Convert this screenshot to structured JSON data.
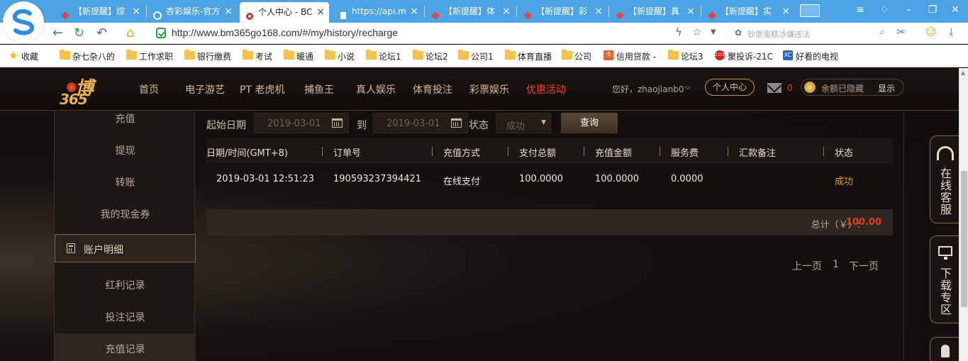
{
  "browser": {
    "tabs": [
      {
        "label": "【新提醒】综",
        "icon_color": "#e8443a"
      },
      {
        "label": "杏彩娱乐-官方",
        "icon_color": "#7a5bd6"
      },
      {
        "label": "个人中心 - BC",
        "icon_color": "#c0392b",
        "active": true
      },
      {
        "label": "https://api.m",
        "icon_color": "#9aa5b1"
      },
      {
        "label": "【新提醒】体",
        "icon_color": "#e8443a"
      },
      {
        "label": "【新提醒】彩",
        "icon_color": "#e8443a"
      },
      {
        "label": "【新提醒】真",
        "icon_color": "#e8443a"
      },
      {
        "label": "【新提醒】实",
        "icon_color": "#e8443a"
      }
    ],
    "url": "http://www.bm365go168.com/#/my/history/recharge",
    "search_placeholder": "钞票蛋糕涉嫌违法",
    "bookmarks": [
      {
        "label": "收藏",
        "kind": "star"
      },
      {
        "label": "杂七杂八的",
        "kind": "folder"
      },
      {
        "label": "工作求职",
        "kind": "folder"
      },
      {
        "label": "银行缴费",
        "kind": "folder"
      },
      {
        "label": "考试",
        "kind": "folder"
      },
      {
        "label": "暖通",
        "kind": "folder"
      },
      {
        "label": "小说",
        "kind": "folder"
      },
      {
        "label": "论坛1",
        "kind": "folder"
      },
      {
        "label": "论坛2",
        "kind": "folder"
      },
      {
        "label": "公司1",
        "kind": "folder"
      },
      {
        "label": "体育直播",
        "kind": "folder"
      },
      {
        "label": "公司",
        "kind": "folder"
      },
      {
        "label": "信用贷款 -",
        "kind": "badge",
        "badge_text": "卡",
        "badge_color": "#e8602c"
      },
      {
        "label": "论坛3",
        "kind": "folder"
      },
      {
        "label": "聚投诉-21C",
        "kind": "badge",
        "badge_text": "21CN",
        "badge_color": "#d81e1e"
      },
      {
        "label": "好看的电视",
        "kind": "badge",
        "badge_text": "XC",
        "badge_color": "#2a62c9"
      }
    ]
  },
  "site": {
    "nav": [
      "首页",
      "电子游艺",
      "PT 老虎机",
      "捕鱼王",
      "真人娱乐",
      "体育投注",
      "彩票娱乐",
      "优惠活动"
    ],
    "greeting": "您好，zhaojianb0",
    "user_center_label": "个人中心",
    "mail_count": "0",
    "balance_text": "余额已隐藏",
    "show_label": "显示"
  },
  "sidebar": {
    "top_items": [
      "充值",
      "提现",
      "转账",
      "我的现金券"
    ],
    "section_title": "账户明细",
    "sub_items": [
      "红利记录",
      "投注记录",
      "充值记录"
    ]
  },
  "filter": {
    "start_label": "起始日期",
    "start_date": "2019-03-01",
    "to_label": "到",
    "end_date": "2019-03-01",
    "status_label": "状态",
    "status_value": "成功",
    "query_label": "查询"
  },
  "table": {
    "headers": [
      "日期/时间(GMT+8)",
      "订单号",
      "充值方式",
      "支付总额",
      "充值金额",
      "服务费",
      "汇款备注",
      "状态"
    ],
    "rows": [
      [
        "2019-03-01 12:51:23",
        "190593237394421",
        "在线支付",
        "100.0000",
        "100.0000",
        "0.0000",
        "",
        "成功"
      ]
    ],
    "total_label": "总计（￥）:",
    "total_value": "100.00"
  },
  "pager": {
    "prev": "上一页",
    "page": "1",
    "next": "下一页"
  },
  "float": {
    "service": [
      "在",
      "线",
      "客",
      "服"
    ],
    "download": [
      "下",
      "载",
      "专",
      "区"
    ]
  }
}
